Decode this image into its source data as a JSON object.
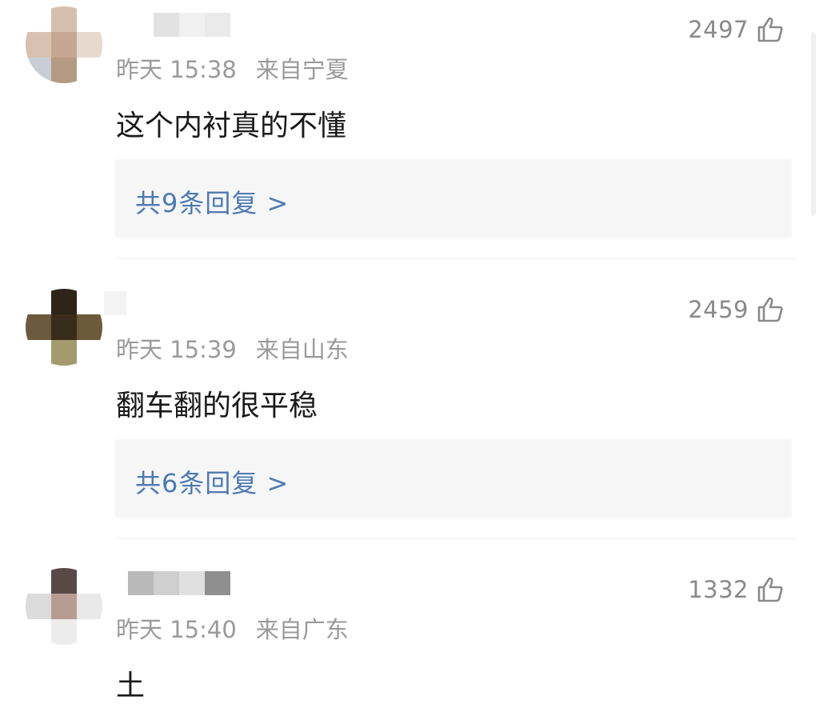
{
  "comments": [
    {
      "time": "昨天 15:38",
      "location": "来自宁夏",
      "text": "这个内衬真的不懂",
      "likes": "2497",
      "replies_label": "共9条回复 >",
      "avatar_colors": [
        "#ffffff",
        "#d6bfae",
        "#ffffff",
        "#d8c1b0",
        "#c4a692",
        "#e8d9cf",
        "#c9cdd6",
        "#b49a83",
        "#ffffff"
      ],
      "username_colors": [
        "#e2e2e2",
        "#f0f0f0",
        "#eaeaea"
      ]
    },
    {
      "time": "昨天 15:39",
      "location": "来自山东",
      "text": "翻车翻的很平稳",
      "likes": "2459",
      "replies_label": "共6条回复 >",
      "avatar_colors": [
        "#ffffff",
        "#2e2418",
        "#ffffff",
        "#6b5a3e",
        "#3a2c1b",
        "#6d5a3a",
        "#ffffff",
        "#a59a6e",
        "#ffffff"
      ],
      "username_colors": [
        "#f3f3f3"
      ]
    },
    {
      "time": "昨天 15:40",
      "location": "来自广东",
      "text": "土",
      "likes": "1332",
      "avatar_colors": [
        "#ffffff",
        "#5a4846",
        "#ffffff",
        "#dcdcdc",
        "#b89c92",
        "#e9e9e9",
        "#ffffff",
        "#ececec",
        "#ffffff"
      ],
      "username_colors": [
        "#b9b9b9",
        "#cfcfcf",
        "#e0e0e0",
        "#8f8f8f"
      ]
    }
  ],
  "colors": {
    "reply_link": "#4e7ab2",
    "meta_text": "#9a9a9a",
    "reply_box_bg": "#f6f6f6"
  },
  "icons": {
    "like": "thumbs-up-outline-icon"
  }
}
